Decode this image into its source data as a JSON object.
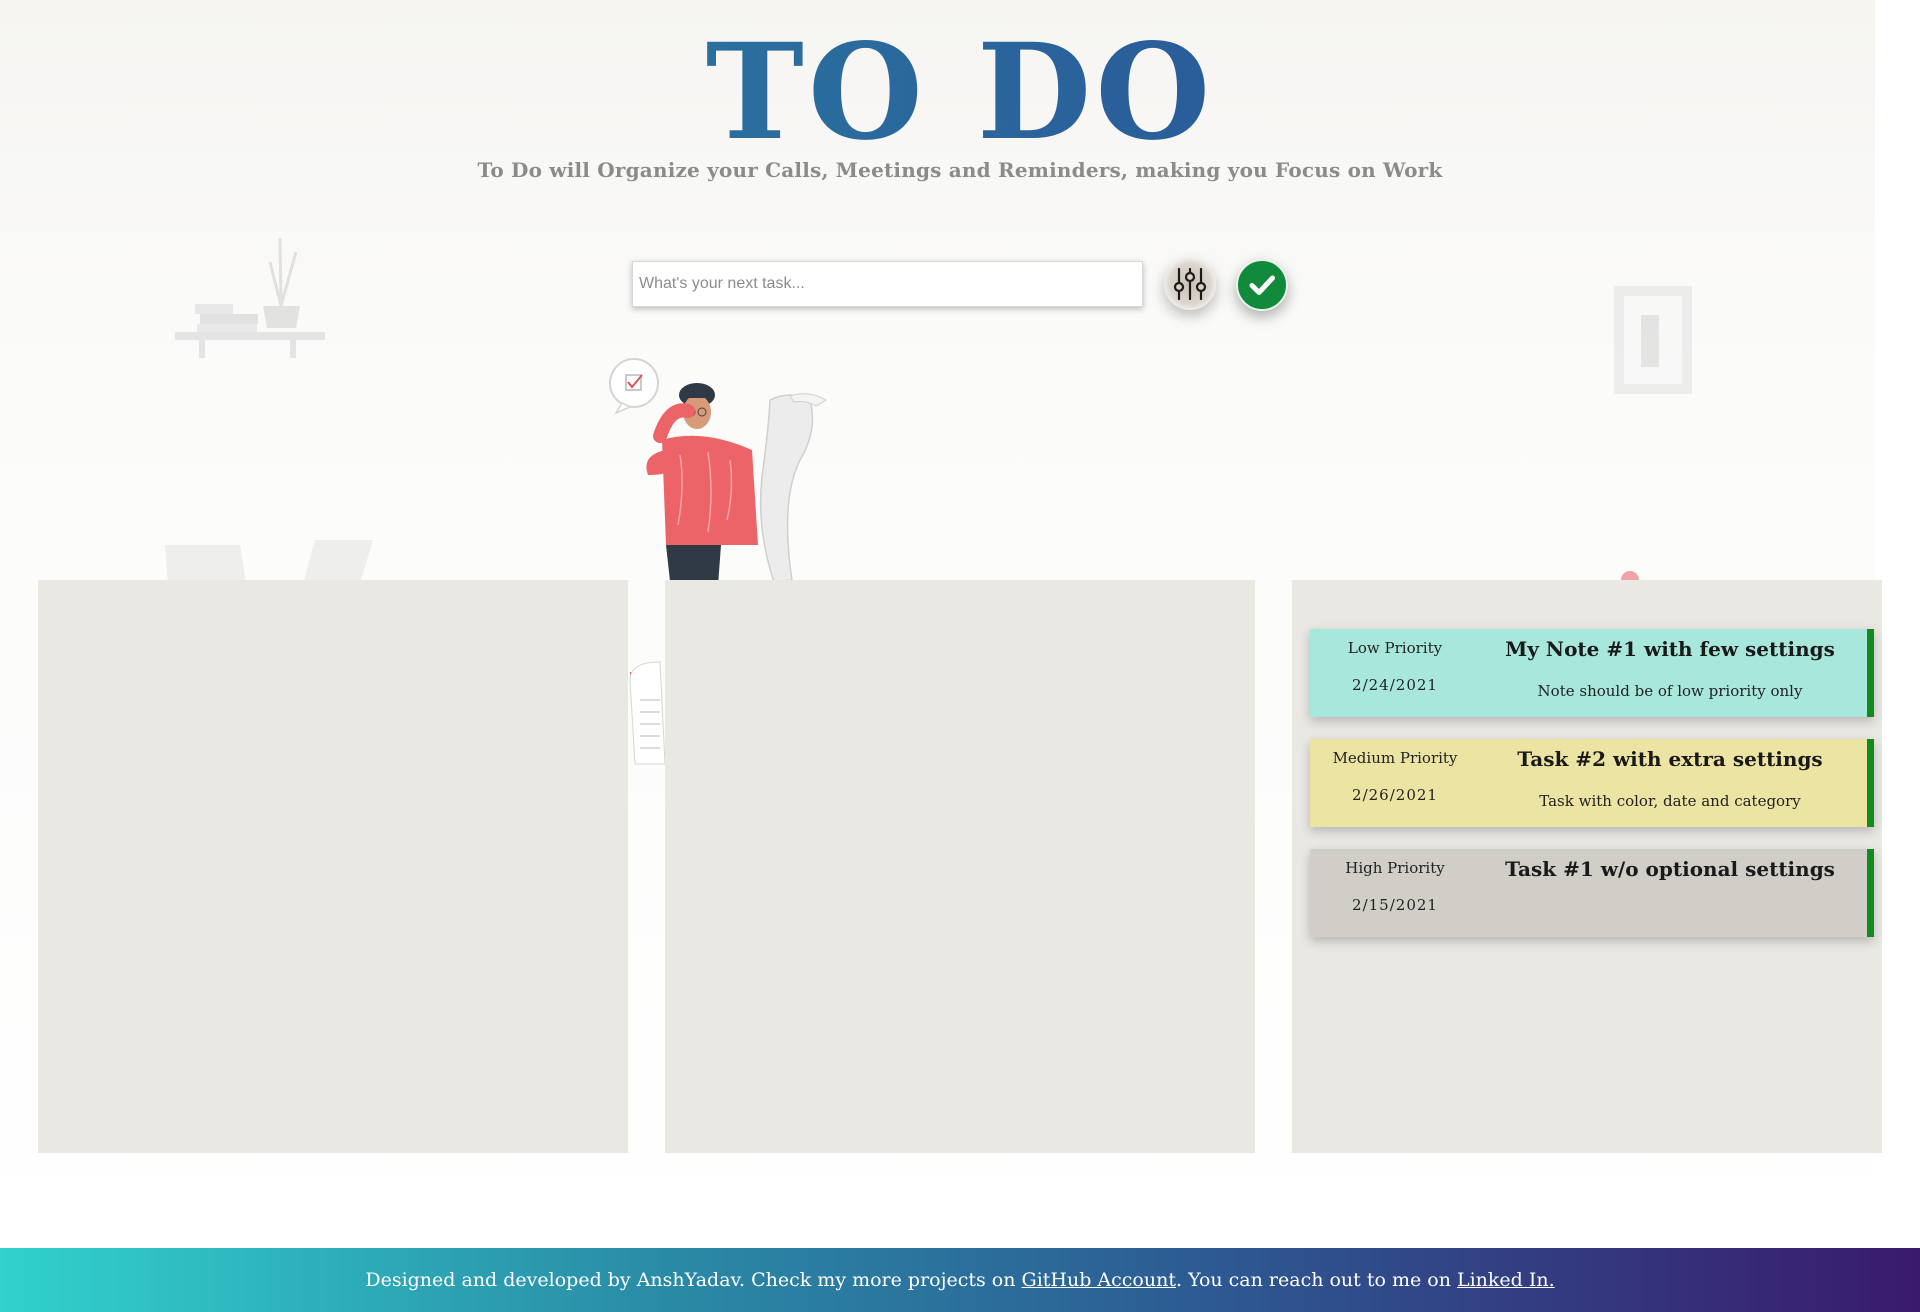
{
  "header": {
    "title": "TO DO",
    "subtitle": "To Do will Organize your Calls, Meetings and Reminders, making you Focus on Work"
  },
  "task_input": {
    "value": "",
    "placeholder": "What's your next task..."
  },
  "controls": {
    "filter_icon": "sliders-icon",
    "submit_icon": "checkmark-icon"
  },
  "columns": [
    {
      "cards": []
    },
    {
      "cards": []
    },
    {
      "cards": [
        {
          "priority": "Low Priority",
          "date": "2/24/2021",
          "title": "My Note #1 with few settings",
          "description": "Note should be of low priority only",
          "color": "#a8e8dc"
        },
        {
          "priority": "Medium Priority",
          "date": "2/26/2021",
          "title": "Task #2 with extra settings",
          "description": "Task with color, date and category",
          "color": "#ece4a2"
        },
        {
          "priority": "High Priority",
          "date": "2/15/2021",
          "title": "Task #1 w/o optional settings",
          "description": "",
          "color": "#d1cec8"
        }
      ]
    }
  ],
  "footer": {
    "text_before": "Designed and developed by AnshYadav. Check my more projects on ",
    "github_link": "GitHub Account",
    "text_middle": ". You can reach out to me on ",
    "linkedin_link": "Linked In."
  },
  "colors": {
    "accent_green": "#128a3c",
    "card_border": "#128a1c",
    "title_start": "#2b8aa6",
    "title_end": "#2b4c90"
  }
}
